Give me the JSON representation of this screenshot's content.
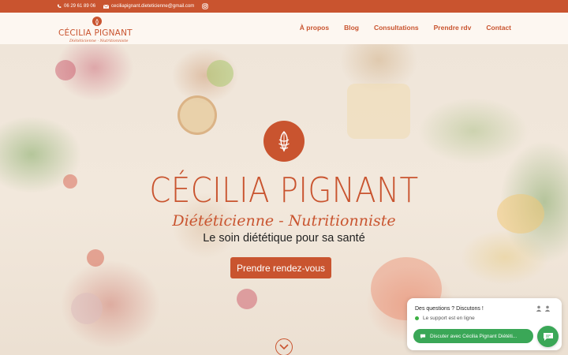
{
  "topbar": {
    "phone": "06 29 61 89 06",
    "email": "ceciliapignant.dieteticienne@gmail.com",
    "phone_icon": "phone-icon",
    "email_icon": "mail-icon",
    "social_icon": "instagram-icon"
  },
  "logo": {
    "name": "CÉCILIA PIGNANT",
    "subtitle": "Diététicienne · Nutritionniste",
    "icon": "pinecone-icon"
  },
  "nav": {
    "items": [
      {
        "label": "À propos"
      },
      {
        "label": "Blog"
      },
      {
        "label": "Consultations"
      },
      {
        "label": "Prendre rdv"
      },
      {
        "label": "Contact"
      }
    ]
  },
  "hero": {
    "title": "CÉCILIA PIGNANT",
    "subtitle": "Diététicienne - Nutritionniste",
    "tagline": "Le soin diététique pour sa santé",
    "cta_label": "Prendre rendez-vous",
    "scroll_icon": "chevron-down-icon"
  },
  "chat": {
    "question": "Des questions ? Discutons !",
    "status": "Le support est en ligne",
    "button_label": "Discuter avec Cécilia Pignant Diététi...",
    "fab_icon": "chat-bubble-icon"
  },
  "colors": {
    "brand": "#c9542f",
    "chat_green": "#3aa757",
    "online": "#3cb043"
  }
}
